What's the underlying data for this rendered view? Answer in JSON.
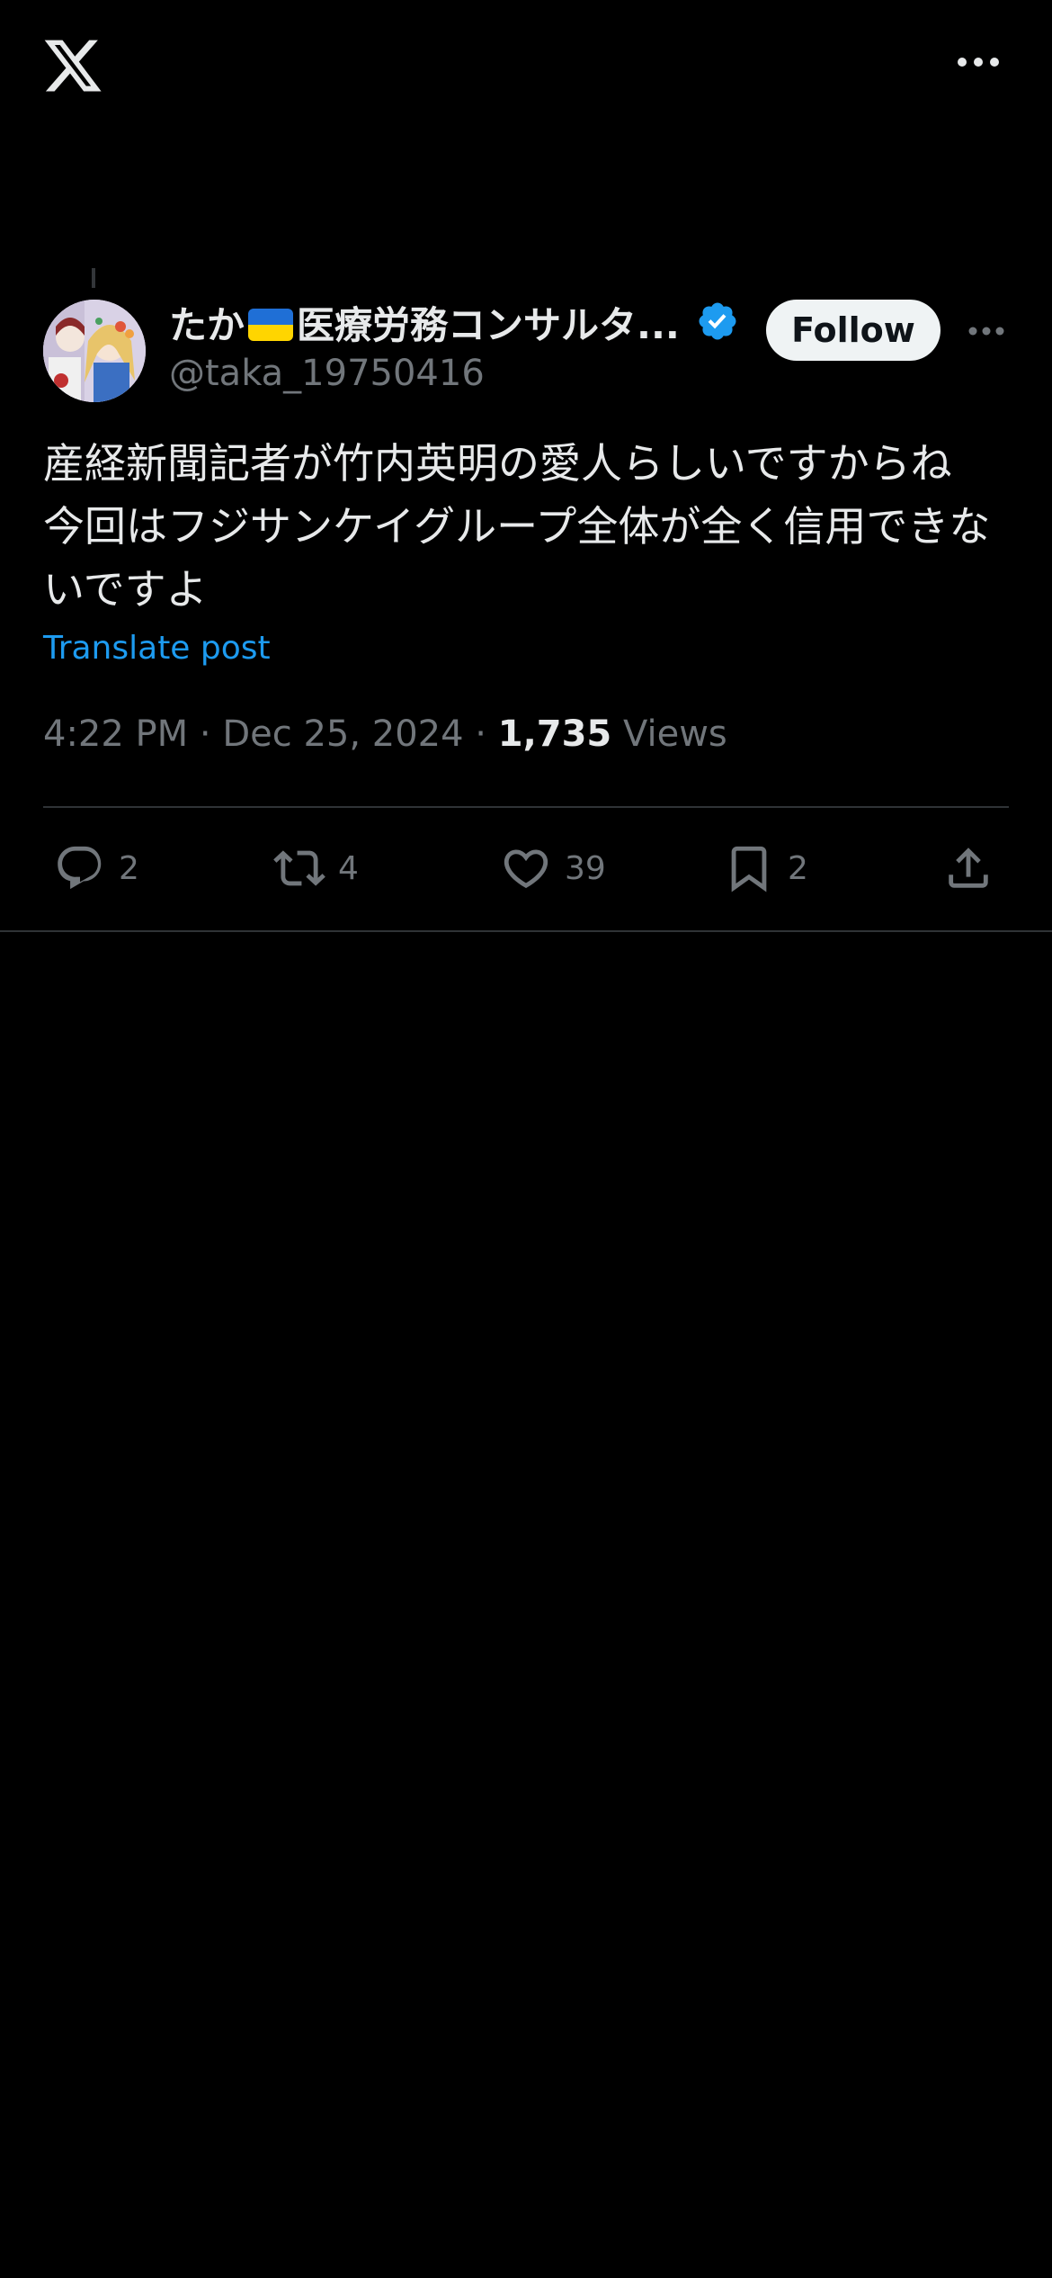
{
  "app": {
    "logo_icon": "x-logo-icon",
    "more_icon": "more-horizontal-icon"
  },
  "tweet": {
    "author": {
      "display_name_prefix": "たか",
      "display_name_suffix": "医療労務コンサルタ...",
      "flag": "ukraine-flag",
      "handle": "@taka_19750416",
      "verified": true
    },
    "follow_label": "Follow",
    "text": "産経新聞記者が竹内英明の愛人らしいですからね\n今回はフジサンケイグループ全体が全く信用できないですよ",
    "translate_label": "Translate post",
    "time": "4:22 PM",
    "date": "Dec 25, 2024",
    "separator": "·",
    "views_count": "1,735",
    "views_label": "Views",
    "stats": {
      "replies": "2",
      "reposts": "4",
      "likes": "39",
      "bookmarks": "2"
    }
  },
  "colors": {
    "background": "#000000",
    "text": "#e7e9ea",
    "muted": "#71767b",
    "accent": "#1d9bf0",
    "divider": "#2f3336"
  }
}
